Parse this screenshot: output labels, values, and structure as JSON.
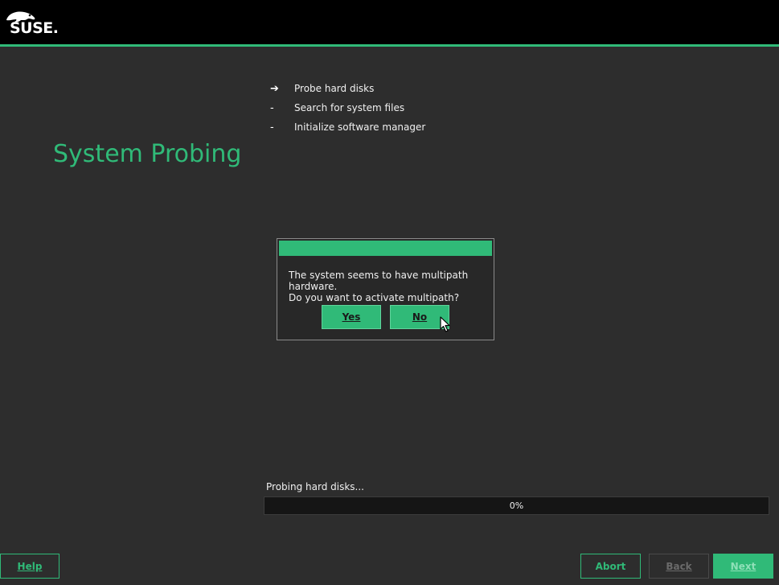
{
  "brand": {
    "logo_text": "SUSE.",
    "accent_color": "#30ba78"
  },
  "page": {
    "title": "System Probing"
  },
  "steps": [
    {
      "marker": "➔",
      "label": "Probe hard disks",
      "state": "current"
    },
    {
      "marker": "-",
      "label": "Search for system files",
      "state": "pending"
    },
    {
      "marker": "-",
      "label": "Initialize software manager",
      "state": "pending"
    }
  ],
  "dialog": {
    "message_line1": "The system seems to have multipath hardware.",
    "message_line2": "Do you want to activate multipath?",
    "yes_label": "Yes",
    "no_label": "No"
  },
  "progress": {
    "label": "Probing hard disks...",
    "percent": 0,
    "percent_text": "0%"
  },
  "footer": {
    "help_label": "Help",
    "abort_label": "Abort",
    "back_label": "Back",
    "next_label": "Next"
  },
  "icons": {
    "logo": "suse-chameleon-icon",
    "cursor": "mouse-pointer-icon"
  }
}
